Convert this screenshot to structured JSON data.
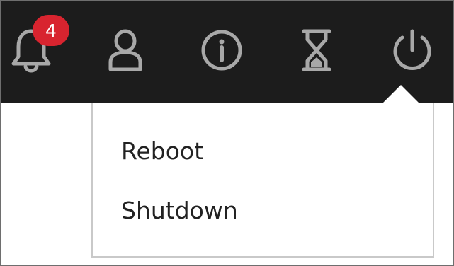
{
  "toolbar": {
    "notifications": {
      "icon": "bell-icon",
      "badge_count": "4",
      "badge_color": "#d8242f"
    },
    "account": {
      "icon": "user-icon"
    },
    "info": {
      "icon": "info-icon"
    },
    "timer": {
      "icon": "hourglass-icon"
    },
    "power": {
      "icon": "power-icon"
    }
  },
  "power_menu": {
    "items": [
      {
        "label": "Reboot"
      },
      {
        "label": "Shutdown"
      }
    ]
  },
  "colors": {
    "toolbar_bg": "#1c1c1c",
    "icon": "#a8a8a8",
    "menu_text": "#222222"
  }
}
